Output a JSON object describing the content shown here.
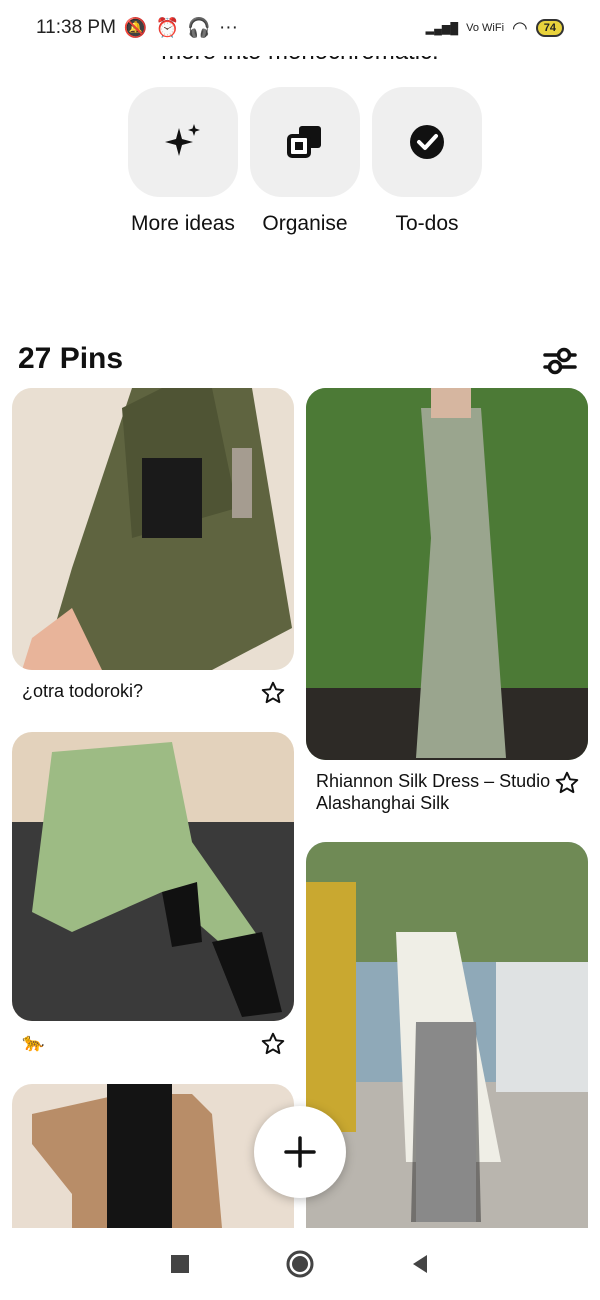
{
  "status": {
    "time": "11:38 PM",
    "more": "···",
    "network": "Vo WiFi",
    "battery": "74"
  },
  "header": {
    "cut_text": "more into monochromatic."
  },
  "actions": [
    {
      "label": "More ideas",
      "icon": "sparkle-icon"
    },
    {
      "label": "Organise",
      "icon": "organise-icon"
    },
    {
      "label": "To-dos",
      "icon": "check-circle-icon"
    }
  ],
  "pins_section": {
    "title": "27 Pins"
  },
  "pins": [
    {
      "caption": "¿otra todoroki?",
      "image": "olive green cropped blazer and skirt set"
    },
    {
      "caption": "Rhiannon Silk Dress – Studio Alashanghai Silk",
      "image": "sage green silk slip dress"
    },
    {
      "caption": "🐆",
      "image": "sage green sweatshirt and trousers"
    },
    {
      "caption": "",
      "image": "camel blazer with black top"
    },
    {
      "caption": "",
      "image": "white coat with zebra print trousers on street"
    }
  ],
  "colors": {
    "accent": "#111111",
    "button_bg": "#efefef",
    "battery": "#e8d23c"
  }
}
